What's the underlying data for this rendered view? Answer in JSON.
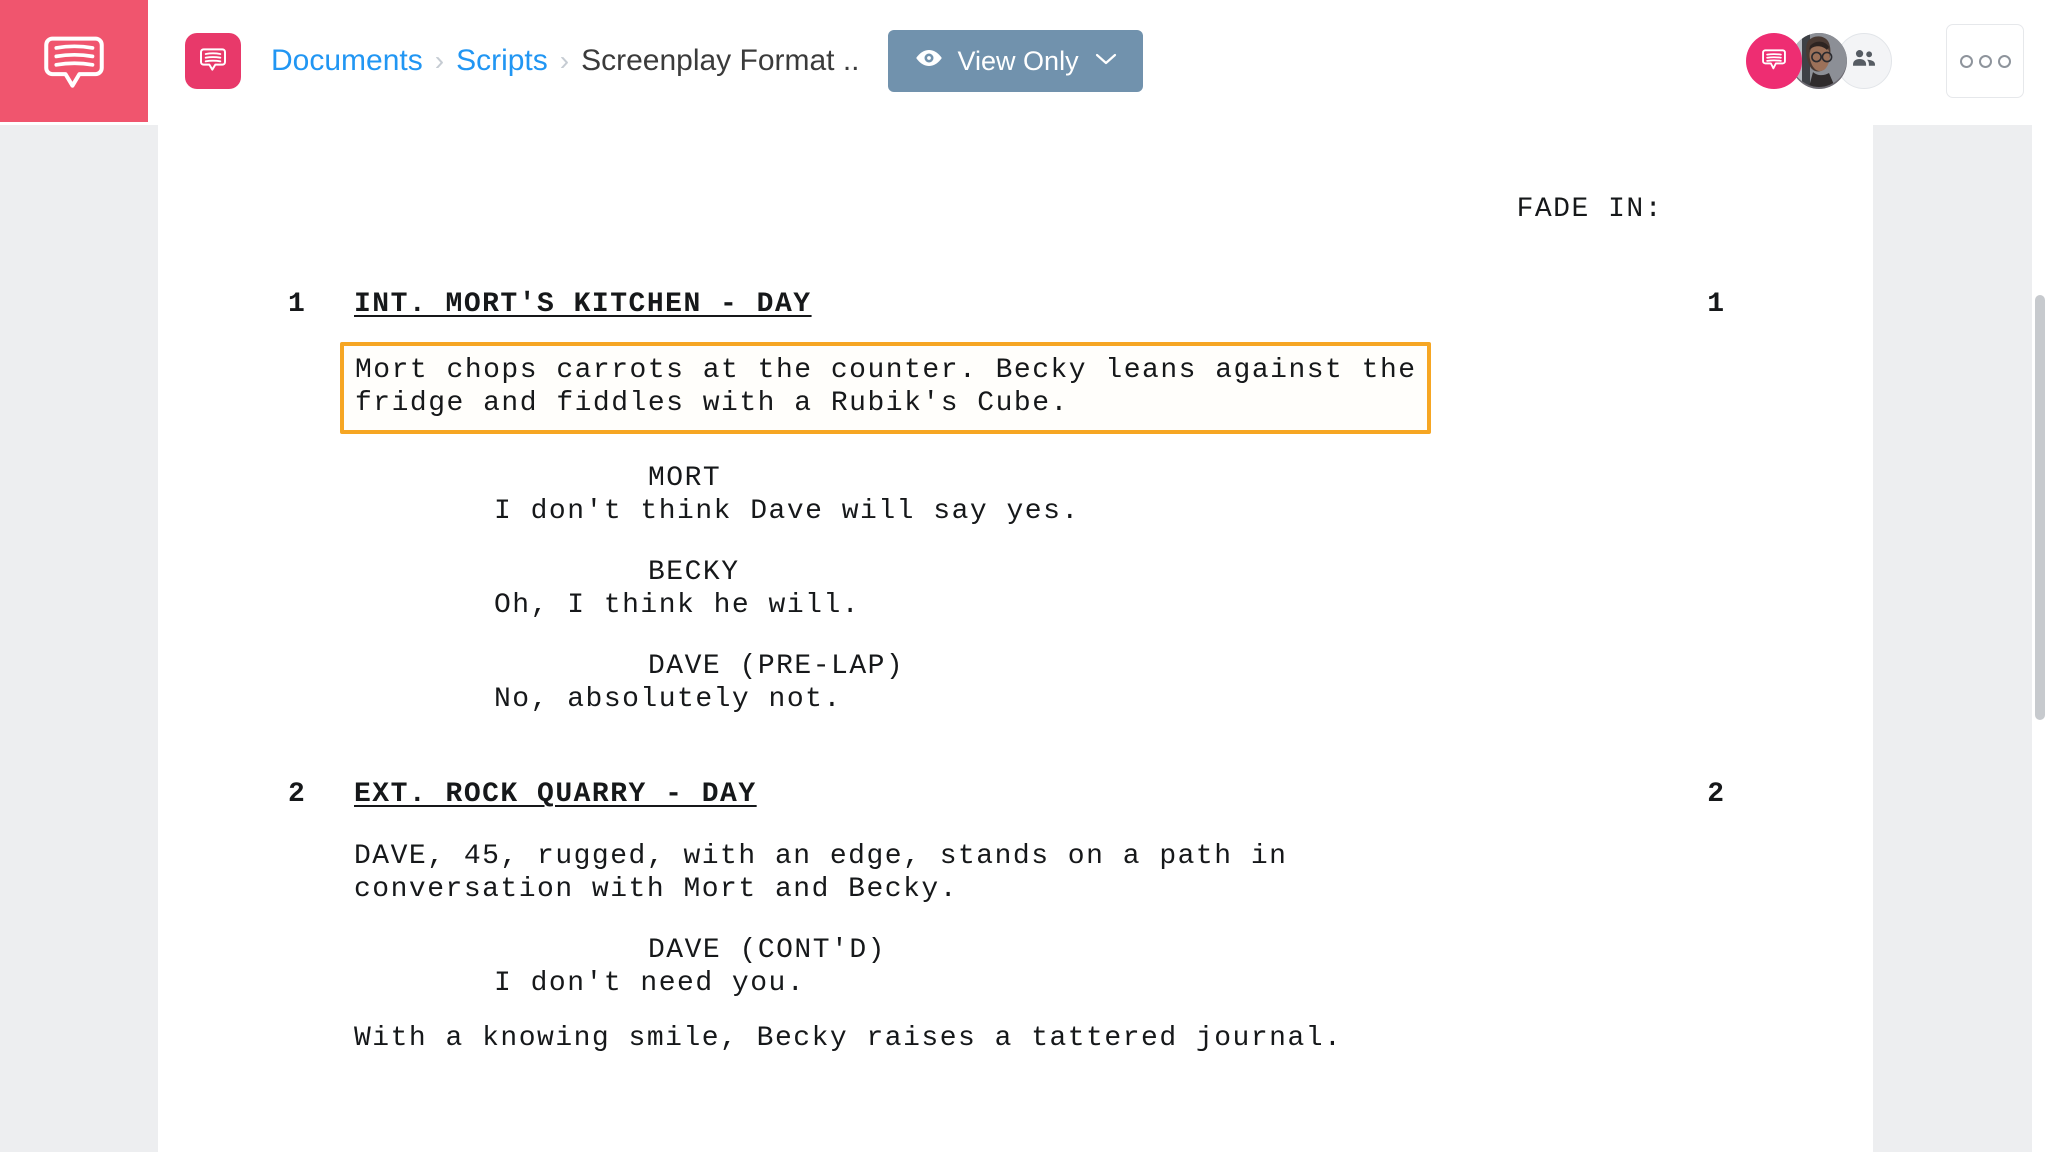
{
  "app": {
    "logo_icon": "script-bubble-logo-icon",
    "background_color": "#f0556e"
  },
  "header": {
    "doc_badge_icon": "script-bubble-icon",
    "breadcrumb": {
      "items": [
        {
          "label": "Documents",
          "type": "link"
        },
        {
          "label": "Scripts",
          "type": "link"
        },
        {
          "label": "Screenplay Format ..",
          "type": "current"
        }
      ],
      "separator": "›"
    },
    "view_mode_button": {
      "label": "View Only",
      "icon": "eye-icon",
      "chevron": "⌄",
      "color": "#7192ad"
    },
    "avatars": [
      {
        "name": "brand-avatar",
        "icon": "script-bubble-icon",
        "color": "#ee2d72"
      },
      {
        "name": "user-avatar",
        "icon": "user-photo"
      },
      {
        "name": "invite-collaborators-avatar",
        "icon": "add-people-icon"
      }
    ],
    "more_button": {
      "icon": "more-options-icon",
      "dots": 3
    }
  },
  "document": {
    "title": "Screenplay Format ..",
    "selection_highlight_color": "#f6a623",
    "content": {
      "transition": "FADE IN:",
      "scenes": [
        {
          "number": "1",
          "heading": "INT. MORT'S KITCHEN - DAY",
          "elements": [
            {
              "type": "action",
              "selected": true,
              "lines": [
                "Mort chops carrots at the counter. Becky leans against the",
                "fridge and fiddles with a Rubik's Cube."
              ]
            },
            {
              "type": "dialogue",
              "character": "MORT",
              "lines": [
                "I don't think Dave will say yes."
              ]
            },
            {
              "type": "dialogue",
              "character": "BECKY",
              "lines": [
                "Oh, I think he will."
              ]
            },
            {
              "type": "dialogue",
              "character": "DAVE (PRE-LAP)",
              "lines": [
                "No, absolutely not."
              ]
            }
          ]
        },
        {
          "number": "2",
          "heading": "EXT. ROCK QUARRY - DAY",
          "elements": [
            {
              "type": "action",
              "selected": false,
              "lines": [
                "DAVE, 45, rugged, with an edge, stands on a path in",
                "conversation with Mort and Becky."
              ]
            },
            {
              "type": "dialogue",
              "character": "DAVE (CONT'D)",
              "lines": [
                "I don't need you."
              ]
            },
            {
              "type": "action",
              "selected": false,
              "lines": [
                "With a knowing smile, Becky raises a tattered journal."
              ]
            }
          ]
        }
      ]
    }
  },
  "scrollbar": {
    "name": "vertical-scrollbar"
  }
}
